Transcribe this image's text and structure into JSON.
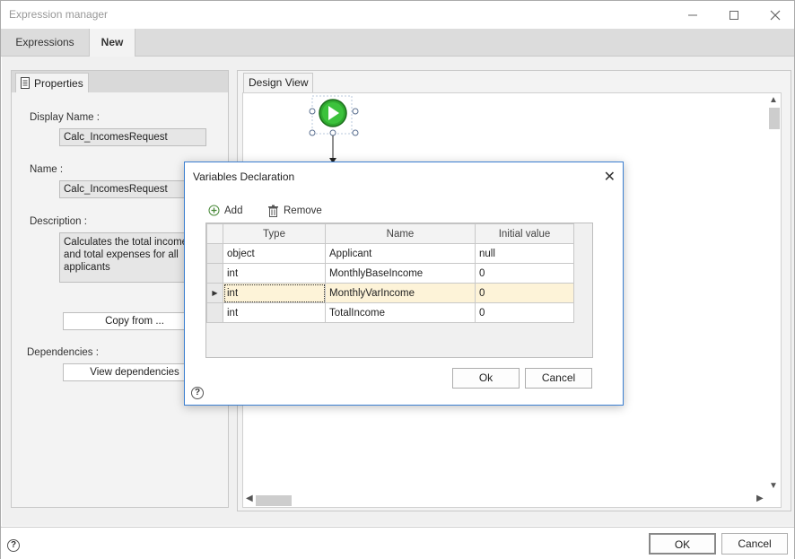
{
  "window": {
    "title": "Expression manager"
  },
  "tabs": [
    {
      "label": "Expressions"
    },
    {
      "label": "New"
    }
  ],
  "properties": {
    "tab_label": "Properties",
    "display_name_label": "Display Name :",
    "display_name_value": "Calc_IncomesRequest",
    "name_label": "Name :",
    "name_value": "Calc_IncomesRequest",
    "description_label": "Description :",
    "description_value": "Calculates the total income and total expenses for all applicants",
    "copy_from_label": "Copy from ...",
    "dependencies_label": "Dependencies :",
    "view_dependencies_label": "View dependencies"
  },
  "design_view": {
    "tab_label": "Design View"
  },
  "dialog": {
    "title": "Variables Declaration",
    "add_label": "Add",
    "remove_label": "Remove",
    "columns": {
      "type": "Type",
      "name": "Name",
      "initial": "Initial value"
    },
    "rows": [
      {
        "type": "object",
        "name": "Applicant",
        "initial": "null"
      },
      {
        "type": "int",
        "name": "MonthlyBaseIncome",
        "initial": "0"
      },
      {
        "type": "int",
        "name": "MonthlyVarIncome",
        "initial": "0"
      },
      {
        "type": "int",
        "name": "TotalIncome",
        "initial": "0"
      }
    ],
    "ok_label": "Ok",
    "cancel_label": "Cancel"
  },
  "footer": {
    "ok_label": "OK",
    "cancel_label": "Cancel"
  },
  "colors": {
    "accent": "#3b7fd1",
    "start_node": "#2fa82f",
    "selected_row": "#fdf3d8"
  }
}
